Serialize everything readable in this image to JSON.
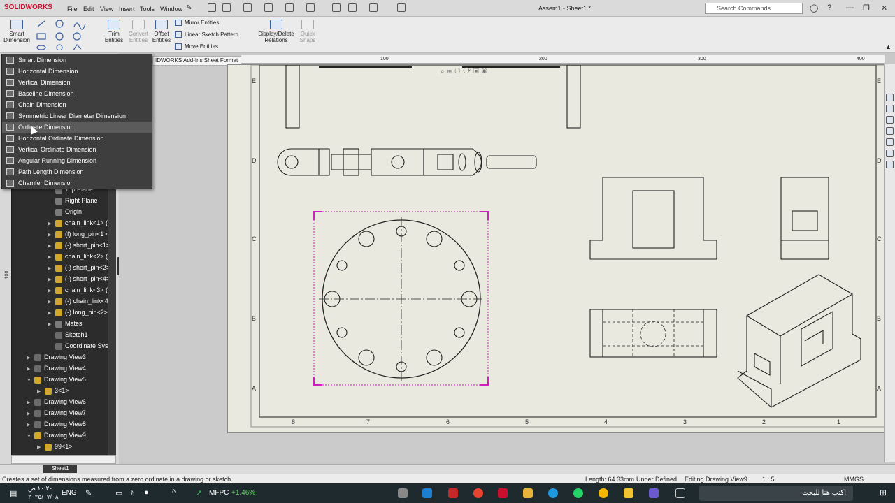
{
  "app": {
    "name": "SOLIDWORKS",
    "document_title": "Assem1 - Sheet1 *"
  },
  "menu": [
    "File",
    "Edit",
    "View",
    "Insert",
    "Tools",
    "Window"
  ],
  "search": {
    "placeholder": "Search Commands"
  },
  "ribbon": {
    "smart_dimension": "Smart\nDimension",
    "trim": "Trim\nEntities",
    "convert": "Convert\nEntities",
    "offset": "Offset\nEntities",
    "mirror": "Mirror Entities",
    "linear_pattern": "Linear Sketch Pattern",
    "move": "Move Entities",
    "display_delete": "Display/Delete\nRelations",
    "quick_snaps": "Quick\nSnaps"
  },
  "tabstrip": "IDWORKS Add-Ins  Sheet Format",
  "dimension_menu": [
    {
      "label": "Smart Dimension",
      "icon": "smart-dimension-icon"
    },
    {
      "label": "Horizontal Dimension",
      "icon": "horizontal-dimension-icon"
    },
    {
      "label": "Vertical Dimension",
      "icon": "vertical-dimension-icon"
    },
    {
      "label": "Baseline Dimension",
      "icon": "baseline-dimension-icon"
    },
    {
      "label": "Chain Dimension",
      "icon": "chain-dimension-icon"
    },
    {
      "label": "Symmetric Linear Diameter Dimension",
      "icon": "symmetric-dimension-icon"
    },
    {
      "label": "Ordinate Dimension",
      "icon": "ordinate-dimension-icon",
      "highlighted": true
    },
    {
      "label": "Horizontal Ordinate Dimension",
      "icon": "horizontal-ordinate-icon"
    },
    {
      "label": "Vertical Ordinate Dimension",
      "icon": "vertical-ordinate-icon"
    },
    {
      "label": "Angular Running Dimension",
      "icon": "angular-running-icon"
    },
    {
      "label": "Path Length Dimension",
      "icon": "path-length-icon"
    },
    {
      "label": "Chamfer Dimension",
      "icon": "chamfer-dimension-icon"
    }
  ],
  "ruler": [
    "100",
    "200",
    "300",
    "400"
  ],
  "tree": [
    {
      "label": "Top Plane",
      "icon": "plane",
      "indent": 3,
      "expand": ""
    },
    {
      "label": "Right Plane",
      "icon": "plane",
      "indent": 3,
      "expand": ""
    },
    {
      "label": "Origin",
      "icon": "plane",
      "indent": 3,
      "expand": ""
    },
    {
      "label": "chain_link<1> (",
      "icon": "part",
      "indent": 3,
      "expand": "▶"
    },
    {
      "label": "(f) long_pin<1>",
      "icon": "part",
      "indent": 3,
      "expand": "▶"
    },
    {
      "label": "(-) short_pin<1>",
      "icon": "part",
      "indent": 3,
      "expand": "▶"
    },
    {
      "label": "chain_link<2> (",
      "icon": "part",
      "indent": 3,
      "expand": "▶"
    },
    {
      "label": "(-) short_pin<2>",
      "icon": "part",
      "indent": 3,
      "expand": "▶"
    },
    {
      "label": "(-) short_pin<4>",
      "icon": "part",
      "indent": 3,
      "expand": "▶"
    },
    {
      "label": "chain_link<3> (",
      "icon": "part",
      "indent": 3,
      "expand": "▶"
    },
    {
      "label": "(-) chain_link<4>",
      "icon": "part",
      "indent": 3,
      "expand": "▶"
    },
    {
      "label": "(-) long_pin<2>",
      "icon": "part",
      "indent": 3,
      "expand": "▶"
    },
    {
      "label": "Mates",
      "icon": "plane",
      "indent": 3,
      "expand": "▶"
    },
    {
      "label": "Sketch1",
      "icon": "sk",
      "indent": 3,
      "expand": ""
    },
    {
      "label": "Coordinate Sys",
      "icon": "sk",
      "indent": 3,
      "expand": ""
    },
    {
      "label": "Drawing View3",
      "icon": "sk",
      "indent": 1,
      "expand": "▶"
    },
    {
      "label": "Drawing View4",
      "icon": "sk",
      "indent": 1,
      "expand": "▶"
    },
    {
      "label": "Drawing View5",
      "icon": "part",
      "indent": 1,
      "expand": "▼"
    },
    {
      "label": "3<1>",
      "icon": "part",
      "indent": 2,
      "expand": "▶"
    },
    {
      "label": "Drawing View6",
      "icon": "sk",
      "indent": 1,
      "expand": "▶"
    },
    {
      "label": "Drawing View7",
      "icon": "sk",
      "indent": 1,
      "expand": "▶"
    },
    {
      "label": "Drawing View8",
      "icon": "sk",
      "indent": 1,
      "expand": "▶"
    },
    {
      "label": "Drawing View9",
      "icon": "part",
      "indent": 1,
      "expand": "▼"
    },
    {
      "label": "99<1>",
      "icon": "part",
      "indent": 2,
      "expand": "▶"
    }
  ],
  "sheet": {
    "zone_letters": [
      "E",
      "D",
      "C",
      "B",
      "A"
    ],
    "zone_numbers": [
      "8",
      "7",
      "6",
      "5",
      "4",
      "3",
      "2",
      "1"
    ]
  },
  "sheet_tab": "Sheet1",
  "status": {
    "hint": "Creates a set of dimensions measured from a zero ordinate in a drawing or sketch.",
    "length": "Length: 64.33mm",
    "state": "Under Defined",
    "editing": "Editing Drawing View9",
    "scale": "1 : 5",
    "units": "MMGS"
  },
  "taskbar": {
    "time": "١٠:٢٠ ص",
    "date": "٢٠٢٥/٠٧/٠٨",
    "lang": "ENG",
    "stock": "MFPC",
    "stock_change": "+1.46%",
    "search": "اكتب هنا للبحث"
  }
}
